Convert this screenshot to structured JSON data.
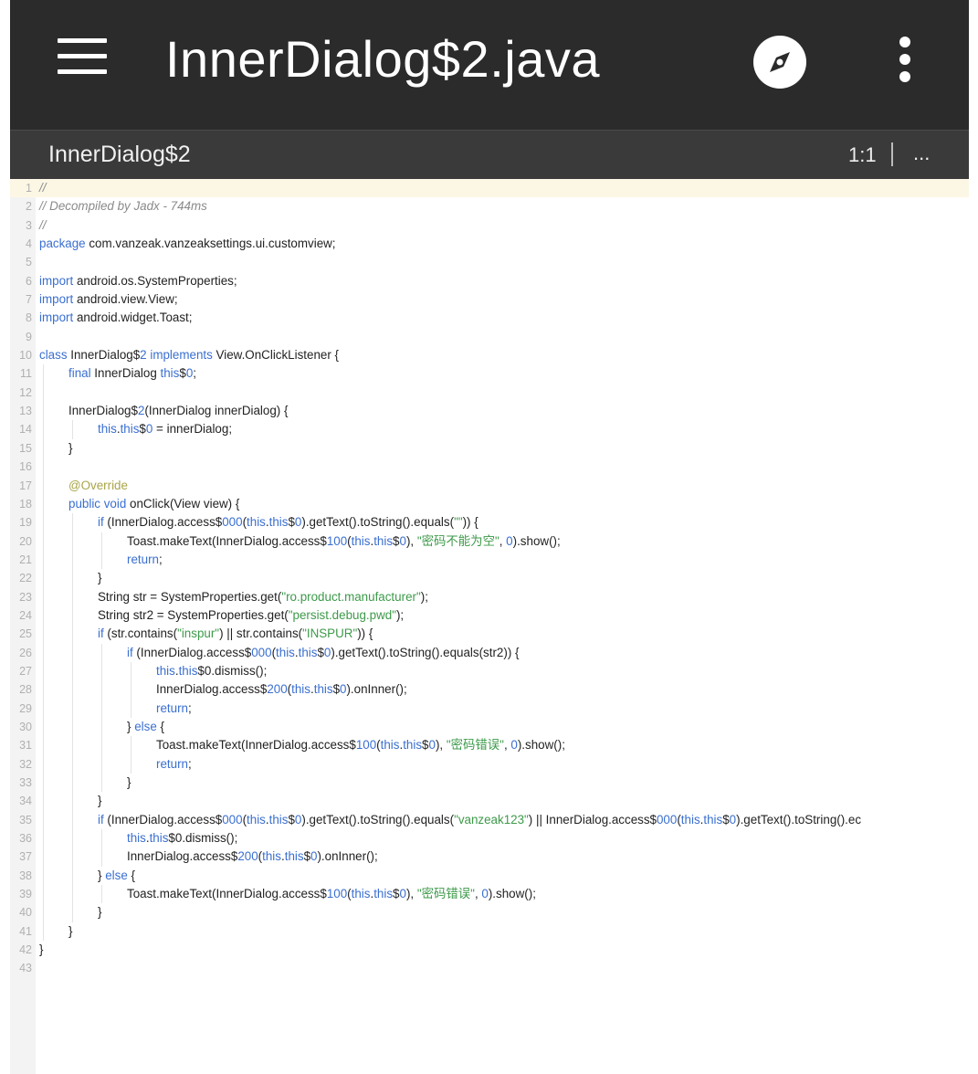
{
  "toolbar": {
    "title": "InnerDialog$2.java",
    "menu_icon": "hamburger-menu-icon",
    "navigate_icon": "compass-icon",
    "more_icon": "more-vert-icon"
  },
  "subbar": {
    "class_name": "InnerDialog$2",
    "cursor_position": "1:1",
    "overflow": "..."
  },
  "colors": {
    "toolbar_bg": "#2b2b2b",
    "subbar_bg": "#3a3a3a",
    "keyword": "#3a6fd0",
    "string": "#3d9a4a",
    "comment": "#8a8a8a",
    "annotation": "#a8a54a",
    "active_line": "#fcf7e4"
  },
  "editor": {
    "lines": [
      {
        "n": "1",
        "indent": 0,
        "tokens": [
          [
            "cm",
            "//"
          ]
        ]
      },
      {
        "n": "2",
        "indent": 0,
        "tokens": [
          [
            "cm",
            "// Decompiled by Jadx - 744ms"
          ]
        ]
      },
      {
        "n": "3",
        "indent": 0,
        "tokens": [
          [
            "cm",
            "//"
          ]
        ]
      },
      {
        "n": "4",
        "indent": 0,
        "tokens": [
          [
            "kw",
            "package"
          ],
          [
            "",
            " com.vanzeak.vanzeaksettings.ui.customview;"
          ]
        ]
      },
      {
        "n": "5",
        "indent": 0,
        "tokens": []
      },
      {
        "n": "6",
        "indent": 0,
        "tokens": [
          [
            "kw",
            "import"
          ],
          [
            "",
            " android.os.SystemProperties;"
          ]
        ]
      },
      {
        "n": "7",
        "indent": 0,
        "tokens": [
          [
            "kw",
            "import"
          ],
          [
            "",
            " android.view.View;"
          ]
        ]
      },
      {
        "n": "8",
        "indent": 0,
        "tokens": [
          [
            "kw",
            "import"
          ],
          [
            "",
            " android.widget.Toast;"
          ]
        ]
      },
      {
        "n": "9",
        "indent": 0,
        "tokens": []
      },
      {
        "n": "10",
        "indent": 0,
        "tokens": [
          [
            "kw",
            "class"
          ],
          [
            "",
            " InnerDialog$"
          ],
          [
            "nu",
            "2"
          ],
          [
            "",
            " "
          ],
          [
            "kw",
            "implements"
          ],
          [
            "",
            " View.OnClickListener {"
          ]
        ]
      },
      {
        "n": "11",
        "indent": 1,
        "tokens": [
          [
            "kw",
            "final"
          ],
          [
            "",
            " InnerDialog "
          ],
          [
            "kw",
            "this"
          ],
          [
            "",
            "$"
          ],
          [
            "nu",
            "0"
          ],
          [
            "",
            ";"
          ]
        ]
      },
      {
        "n": "12",
        "indent": 1,
        "tokens": []
      },
      {
        "n": "13",
        "indent": 1,
        "tokens": [
          [
            "",
            "InnerDialog$"
          ],
          [
            "nu",
            "2"
          ],
          [
            "",
            "(InnerDialog innerDialog) {"
          ]
        ]
      },
      {
        "n": "14",
        "indent": 2,
        "tokens": [
          [
            "kw",
            "this"
          ],
          [
            "",
            "."
          ],
          [
            "kw",
            "this"
          ],
          [
            "",
            "$"
          ],
          [
            "nu",
            "0"
          ],
          [
            "",
            " = innerDialog;"
          ]
        ]
      },
      {
        "n": "15",
        "indent": 1,
        "tokens": [
          [
            "",
            "}"
          ]
        ]
      },
      {
        "n": "16",
        "indent": 1,
        "tokens": []
      },
      {
        "n": "17",
        "indent": 1,
        "tokens": [
          [
            "an",
            "@Override"
          ]
        ]
      },
      {
        "n": "18",
        "indent": 1,
        "tokens": [
          [
            "kw",
            "public"
          ],
          [
            "",
            " "
          ],
          [
            "kw",
            "void"
          ],
          [
            "",
            " onClick(View view) {"
          ]
        ]
      },
      {
        "n": "19",
        "indent": 2,
        "tokens": [
          [
            "kw",
            "if"
          ],
          [
            "",
            " (InnerDialog.access$"
          ],
          [
            "nu",
            "000"
          ],
          [
            "",
            "("
          ],
          [
            "kw",
            "this"
          ],
          [
            "",
            "."
          ],
          [
            "kw",
            "this"
          ],
          [
            "",
            "$"
          ],
          [
            "nu",
            "0"
          ],
          [
            "",
            ").getText().toString().equals("
          ],
          [
            "st",
            "\"\""
          ],
          [
            "",
            ")) {"
          ]
        ]
      },
      {
        "n": "20",
        "indent": 3,
        "tokens": [
          [
            "",
            "Toast.makeText(InnerDialog.access$"
          ],
          [
            "nu",
            "100"
          ],
          [
            "",
            "("
          ],
          [
            "kw",
            "this"
          ],
          [
            "",
            "."
          ],
          [
            "kw",
            "this"
          ],
          [
            "",
            "$"
          ],
          [
            "nu",
            "0"
          ],
          [
            "",
            "), "
          ],
          [
            "st",
            "\"密码不能为空\""
          ],
          [
            "",
            ", "
          ],
          [
            "nu",
            "0"
          ],
          [
            "",
            ").show();"
          ]
        ]
      },
      {
        "n": "21",
        "indent": 3,
        "tokens": [
          [
            "kw",
            "return"
          ],
          [
            "",
            ";"
          ]
        ]
      },
      {
        "n": "22",
        "indent": 2,
        "tokens": [
          [
            "",
            "}"
          ]
        ]
      },
      {
        "n": "23",
        "indent": 2,
        "tokens": [
          [
            "",
            "String str = SystemProperties.get("
          ],
          [
            "st",
            "\"ro.product.manufacturer\""
          ],
          [
            "",
            ");"
          ]
        ]
      },
      {
        "n": "24",
        "indent": 2,
        "tokens": [
          [
            "",
            "String str2 = SystemProperties.get("
          ],
          [
            "st",
            "\"persist.debug.pwd\""
          ],
          [
            "",
            ");"
          ]
        ]
      },
      {
        "n": "25",
        "indent": 2,
        "tokens": [
          [
            "kw",
            "if"
          ],
          [
            "",
            " (str.contains("
          ],
          [
            "st",
            "\"inspur\""
          ],
          [
            "",
            ") || str.contains("
          ],
          [
            "st",
            "\"INSPUR\""
          ],
          [
            "",
            ")) {"
          ]
        ]
      },
      {
        "n": "26",
        "indent": 3,
        "tokens": [
          [
            "kw",
            "if"
          ],
          [
            "",
            " (InnerDialog.access$"
          ],
          [
            "nu",
            "000"
          ],
          [
            "",
            "("
          ],
          [
            "kw",
            "this"
          ],
          [
            "",
            "."
          ],
          [
            "kw",
            "this"
          ],
          [
            "",
            "$"
          ],
          [
            "nu",
            "0"
          ],
          [
            "",
            ").getText().toString().equals(str2)) {"
          ]
        ]
      },
      {
        "n": "27",
        "indent": 4,
        "tokens": [
          [
            "kw",
            "this"
          ],
          [
            "",
            "."
          ],
          [
            "kw",
            "this"
          ],
          [
            "",
            "$0.dismiss();"
          ]
        ]
      },
      {
        "n": "28",
        "indent": 4,
        "tokens": [
          [
            "",
            "InnerDialog.access$"
          ],
          [
            "nu",
            "200"
          ],
          [
            "",
            "("
          ],
          [
            "kw",
            "this"
          ],
          [
            "",
            "."
          ],
          [
            "kw",
            "this"
          ],
          [
            "",
            "$"
          ],
          [
            "nu",
            "0"
          ],
          [
            "",
            ").onInner();"
          ]
        ]
      },
      {
        "n": "29",
        "indent": 4,
        "tokens": [
          [
            "kw",
            "return"
          ],
          [
            "",
            ";"
          ]
        ]
      },
      {
        "n": "30",
        "indent": 3,
        "tokens": [
          [
            "",
            "} "
          ],
          [
            "kw",
            "else"
          ],
          [
            "",
            " {"
          ]
        ]
      },
      {
        "n": "31",
        "indent": 4,
        "tokens": [
          [
            "",
            "Toast.makeText(InnerDialog.access$"
          ],
          [
            "nu",
            "100"
          ],
          [
            "",
            "("
          ],
          [
            "kw",
            "this"
          ],
          [
            "",
            "."
          ],
          [
            "kw",
            "this"
          ],
          [
            "",
            "$"
          ],
          [
            "nu",
            "0"
          ],
          [
            "",
            "), "
          ],
          [
            "st",
            "\"密码错误\""
          ],
          [
            "",
            ", "
          ],
          [
            "nu",
            "0"
          ],
          [
            "",
            ").show();"
          ]
        ]
      },
      {
        "n": "32",
        "indent": 4,
        "tokens": [
          [
            "kw",
            "return"
          ],
          [
            "",
            ";"
          ]
        ]
      },
      {
        "n": "33",
        "indent": 3,
        "tokens": [
          [
            "",
            "}"
          ]
        ]
      },
      {
        "n": "34",
        "indent": 2,
        "tokens": [
          [
            "",
            "}"
          ]
        ]
      },
      {
        "n": "35",
        "indent": 2,
        "tokens": [
          [
            "kw",
            "if"
          ],
          [
            "",
            " (InnerDialog.access$"
          ],
          [
            "nu",
            "000"
          ],
          [
            "",
            "("
          ],
          [
            "kw",
            "this"
          ],
          [
            "",
            "."
          ],
          [
            "kw",
            "this"
          ],
          [
            "",
            "$"
          ],
          [
            "nu",
            "0"
          ],
          [
            "",
            ").getText().toString().equals("
          ],
          [
            "st",
            "\"vanzeak123\""
          ],
          [
            "",
            ") || InnerDialog.access$"
          ],
          [
            "nu",
            "000"
          ],
          [
            "",
            "("
          ],
          [
            "kw",
            "this"
          ],
          [
            "",
            "."
          ],
          [
            "kw",
            "this"
          ],
          [
            "",
            "$"
          ],
          [
            "nu",
            "0"
          ],
          [
            "",
            ").getText().toString().ec"
          ]
        ]
      },
      {
        "n": "36",
        "indent": 3,
        "tokens": [
          [
            "kw",
            "this"
          ],
          [
            "",
            "."
          ],
          [
            "kw",
            "this"
          ],
          [
            "",
            "$0.dismiss();"
          ]
        ]
      },
      {
        "n": "37",
        "indent": 3,
        "tokens": [
          [
            "",
            "InnerDialog.access$"
          ],
          [
            "nu",
            "200"
          ],
          [
            "",
            "("
          ],
          [
            "kw",
            "this"
          ],
          [
            "",
            "."
          ],
          [
            "kw",
            "this"
          ],
          [
            "",
            "$"
          ],
          [
            "nu",
            "0"
          ],
          [
            "",
            ").onInner();"
          ]
        ]
      },
      {
        "n": "38",
        "indent": 2,
        "tokens": [
          [
            "",
            "} "
          ],
          [
            "kw",
            "else"
          ],
          [
            "",
            " {"
          ]
        ]
      },
      {
        "n": "39",
        "indent": 3,
        "tokens": [
          [
            "",
            "Toast.makeText(InnerDialog.access$"
          ],
          [
            "nu",
            "100"
          ],
          [
            "",
            "("
          ],
          [
            "kw",
            "this"
          ],
          [
            "",
            "."
          ],
          [
            "kw",
            "this"
          ],
          [
            "",
            "$"
          ],
          [
            "nu",
            "0"
          ],
          [
            "",
            "), "
          ],
          [
            "st",
            "\"密码错误\""
          ],
          [
            "",
            ", "
          ],
          [
            "nu",
            "0"
          ],
          [
            "",
            ").show();"
          ]
        ]
      },
      {
        "n": "40",
        "indent": 2,
        "tokens": [
          [
            "",
            "}"
          ]
        ]
      },
      {
        "n": "41",
        "indent": 1,
        "tokens": [
          [
            "",
            "}"
          ]
        ]
      },
      {
        "n": "42",
        "indent": 0,
        "tokens": [
          [
            "",
            "}"
          ]
        ]
      },
      {
        "n": "43",
        "indent": 0,
        "tokens": []
      }
    ]
  }
}
